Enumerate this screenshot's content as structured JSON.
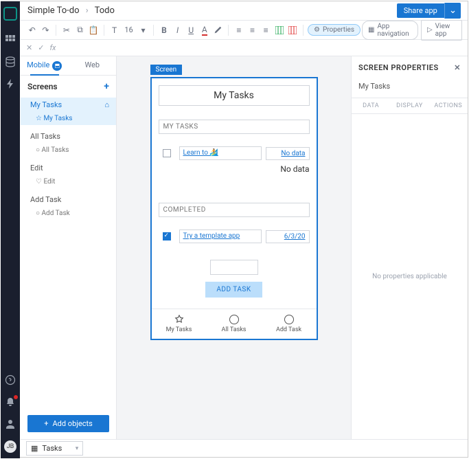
{
  "breadcrumb": {
    "app": "Simple To-do",
    "page": "Todo"
  },
  "header": {
    "share": "Share app",
    "viewapp": "View app"
  },
  "toolbar": {
    "font": "T",
    "fontsize": "16",
    "properties": "Properties",
    "appnav": "App navigation"
  },
  "fx": {
    "label": "fx"
  },
  "left": {
    "tab_mobile": "Mobile",
    "tab_web": "Web",
    "screens": "Screens",
    "items": [
      {
        "name": "My Tasks",
        "children": [
          {
            "name": "My Tasks",
            "star": true
          }
        ]
      },
      {
        "name": "All Tasks",
        "children": [
          {
            "name": "All Tasks"
          }
        ]
      },
      {
        "name": "Edit",
        "children": [
          {
            "name": "Edit"
          }
        ]
      },
      {
        "name": "Add Task",
        "children": [
          {
            "name": "Add Task"
          }
        ]
      }
    ],
    "add_objects": "Add objects"
  },
  "canvas": {
    "screen_tag": "Screen",
    "title": "My Tasks",
    "section1": "MY TASKS",
    "task1_text": "Learn to 🏄",
    "nodata": "No data",
    "section2": "COMPLETED",
    "task2_text": "Try a template app",
    "task2_date": "6/3/20",
    "addtask": "ADD TASK",
    "nav": {
      "mytasks": "My Tasks",
      "alltasks": "All Tasks",
      "addtask": "Add Task"
    }
  },
  "right": {
    "header": "SCREEN PROPERTIES",
    "title": "My Tasks",
    "tabs": {
      "data": "DATA",
      "display": "DISPLAY",
      "actions": "ACTIONS"
    },
    "empty": "No properties applicable"
  },
  "bottom": {
    "datasource": "Tasks"
  },
  "avatar": "JB"
}
